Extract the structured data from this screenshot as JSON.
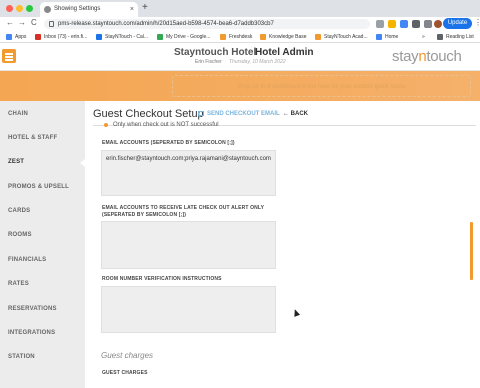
{
  "browser": {
    "tab_title": "Showing Settings",
    "tab_close": "×",
    "new_tab": "+",
    "url": "pms-release.stayntouch.com/admin/h/20d15aed-b598-4574-bea6-d7addb303cb7",
    "update_label": "Update",
    "kebab": "⋮",
    "nav": {
      "back": "←",
      "forward": "→",
      "reload": "C"
    },
    "bookmarks": [
      {
        "label": "Apps",
        "color": "#4285f4"
      },
      {
        "label": "Inbox (73) - erin.fi...",
        "color": "#d93025"
      },
      {
        "label": "StayNTouch - Cal...",
        "color": "#1a73e8"
      },
      {
        "label": "My Drive - Google...",
        "color": "#34a853"
      },
      {
        "label": "Freshdesk",
        "color": "#f39a2f"
      },
      {
        "label": "Knowledge Base",
        "color": "#f39a2f"
      },
      {
        "label": "StayNTouch Acad...",
        "color": "#f39a2f"
      },
      {
        "label": "Home",
        "color": "#4285f4"
      }
    ],
    "bookmarks_more": "»",
    "reading_list": "Reading List"
  },
  "header": {
    "hotel_name": "Stayntouch Hotel",
    "admin_label": "Hotel Admin",
    "user_name": "Erin Fischer",
    "date": "Thursday, 10 March 2022",
    "logo_a": "stay",
    "logo_n": "n",
    "logo_b": "touch"
  },
  "banner": {
    "dropzone_text": "Drop up to 8 dashboard icons here for your custom quick menu"
  },
  "sidebar": {
    "items": [
      {
        "label": "CHAIN",
        "active": false
      },
      {
        "label": "HOTEL & STAFF",
        "active": false
      },
      {
        "label": "ZEST",
        "active": true
      },
      {
        "label": "PROMOS & UPSELL",
        "active": false
      },
      {
        "label": "CARDS",
        "active": false
      },
      {
        "label": "ROOMS",
        "active": false
      },
      {
        "label": "FINANCIALS",
        "active": false
      },
      {
        "label": "RATES",
        "active": false
      },
      {
        "label": "RESERVATIONS",
        "active": false
      },
      {
        "label": "INTEGRATIONS",
        "active": false
      },
      {
        "label": "STATION",
        "active": false
      }
    ]
  },
  "main": {
    "title": "Guest Checkout Setup",
    "send_email": "SEND CHECKOUT EMAIL",
    "back": "BACK",
    "partial_option": "Only when check out is NOT successful",
    "email_accounts_label": "EMAIL ACCOUNTS (SEPERATED BY SEMICOLON [;])",
    "email_accounts_value": "erin.fischer@stayntouch.com;priya.rajamani@stayntouch.com",
    "late_checkout_label": "EMAIL ACCOUNTS TO RECEIVE LATE CHECK OUT ALERT ONLY (SEPERATED BY SEMICOLON [;])",
    "late_checkout_value": "",
    "room_verification_label": "ROOM NUMBER VERIFICATION INSTRUCTIONS",
    "room_verification_value": "",
    "guest_charges_title": "Guest charges",
    "guest_charges_label": "GUEST CHARGES"
  },
  "colors": {
    "accent": "#f39a2f",
    "link": "#7bb4dc",
    "sidebar_bg": "#ececec"
  }
}
